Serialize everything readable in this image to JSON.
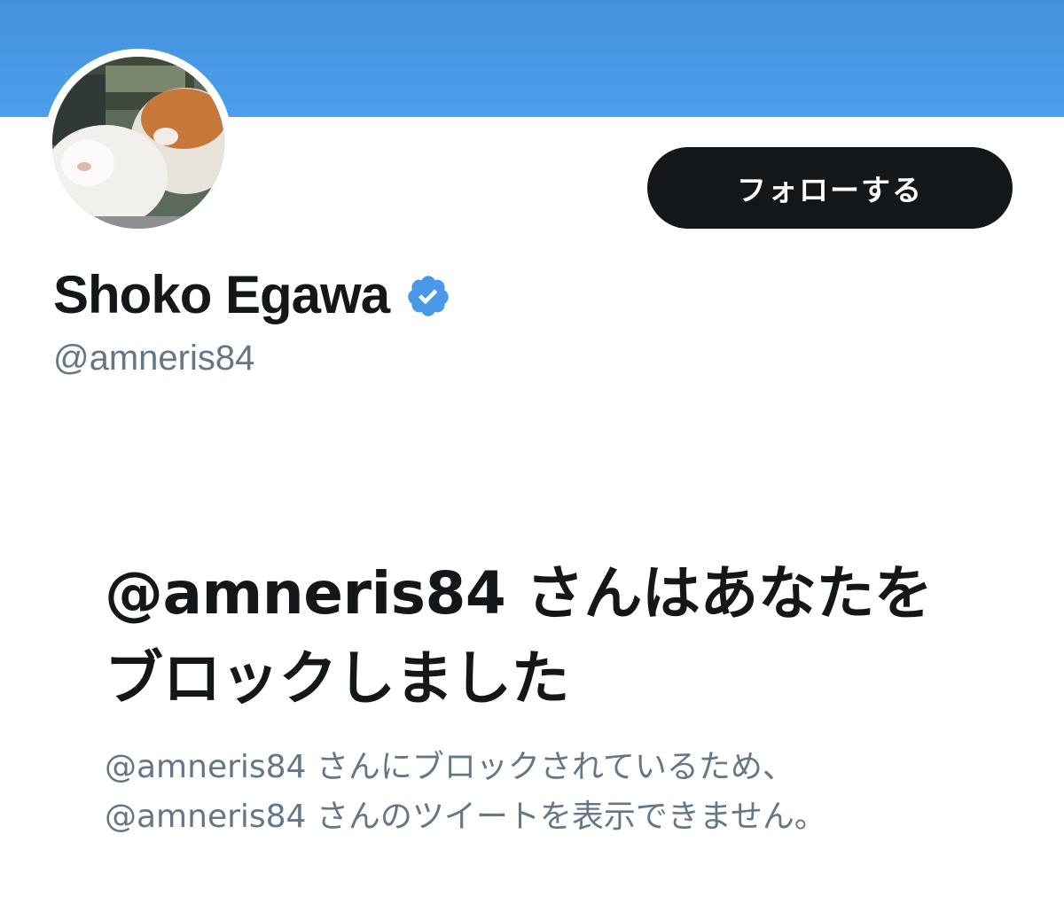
{
  "profile": {
    "display_name": "Shoko Egawa",
    "handle": "@amneris84",
    "verified": true,
    "avatar_icon": "cats-avatar"
  },
  "actions": {
    "follow_label": "フォローする"
  },
  "blocked": {
    "title": "@amneris84 さんはあなたをブロックしました",
    "description_line1": "@amneris84 さんにブロックされているため、",
    "description_line2": "@amneris84 さんのツイートを表示できません。"
  },
  "colors": {
    "banner": "#4a9be8",
    "button_bg": "#14171a",
    "verified_badge": "#4a99e9",
    "secondary_text": "#657786"
  }
}
